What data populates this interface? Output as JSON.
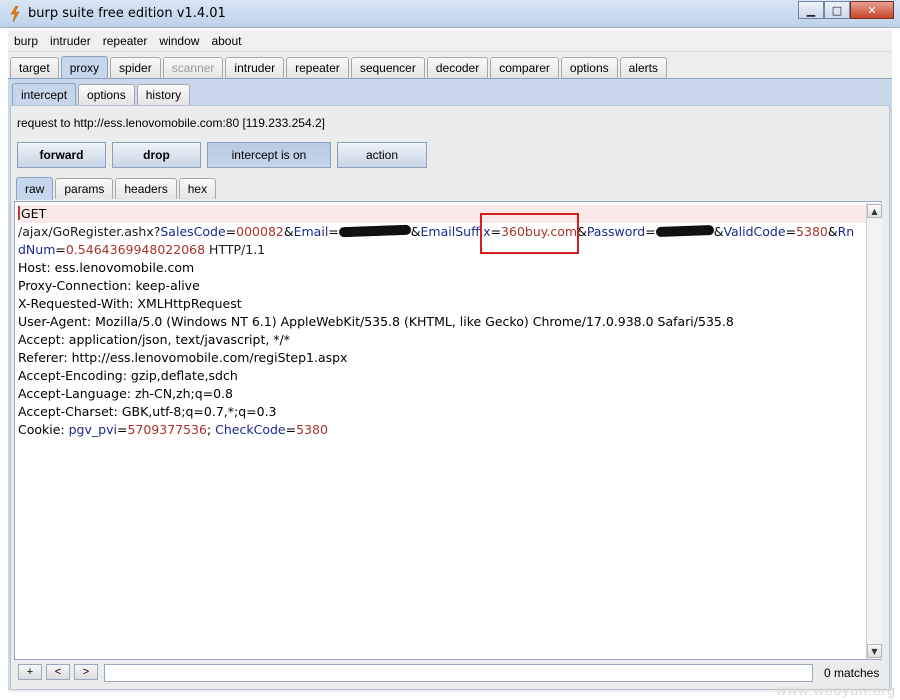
{
  "window": {
    "title": "burp suite free edition v1.4.01",
    "controls": {
      "minimize": "▁",
      "maximize": "□",
      "close": "✕"
    }
  },
  "menu": [
    "burp",
    "intruder",
    "repeater",
    "window",
    "about"
  ],
  "main_tabs": [
    {
      "label": "target"
    },
    {
      "label": "proxy",
      "active": true
    },
    {
      "label": "spider"
    },
    {
      "label": "scanner",
      "disabled": true
    },
    {
      "label": "intruder"
    },
    {
      "label": "repeater"
    },
    {
      "label": "sequencer"
    },
    {
      "label": "decoder"
    },
    {
      "label": "comparer"
    },
    {
      "label": "options"
    },
    {
      "label": "alerts"
    }
  ],
  "proxy_tabs": [
    {
      "label": "intercept",
      "active": true
    },
    {
      "label": "options"
    },
    {
      "label": "history"
    }
  ],
  "request_info": "request to http://ess.lenovomobile.com:80  [119.233.254.2]",
  "buttons": {
    "forward": "forward",
    "drop": "drop",
    "intercept": "intercept is on",
    "action": "action"
  },
  "view_tabs": [
    {
      "label": "raw",
      "active": true
    },
    {
      "label": "params"
    },
    {
      "label": "headers"
    },
    {
      "label": "hex"
    }
  ],
  "request": {
    "method": "GET",
    "path": "/ajax/GoRegister.ashx?",
    "params": {
      "sales_code_key": "SalesCode",
      "sales_code_val": "000082",
      "email_key": "Email",
      "email_suffix_key": "EmailSuffix",
      "email_suffix_val": "360buy.com",
      "password_key": "Password",
      "valid_code_key": "ValidCode",
      "valid_code_val": "5380",
      "rn_key_part1": "Rn",
      "rn_key_part2": "dNum",
      "rn_val": "0.5464369948022068",
      "protocol": "HTTP/1.1"
    },
    "headers": [
      "Host: ess.lenovomobile.com",
      "Proxy-Connection: keep-alive",
      "X-Requested-With: XMLHttpRequest",
      "User-Agent: Mozilla/5.0 (Windows NT 6.1) AppleWebKit/535.8 (KHTML, like Gecko) Chrome/17.0.938.0 Safari/535.8",
      "Accept: application/json, text/javascript, */*",
      "Referer: http://ess.lenovomobile.com/regiStep1.aspx",
      "Accept-Encoding: gzip,deflate,sdch",
      "Accept-Language: zh-CN,zh;q=0.8",
      "Accept-Charset: GBK,utf-8;q=0.7,*;q=0.3"
    ],
    "cookie": {
      "label": "Cookie: ",
      "pgv_key": "pgv_pvi",
      "pgv_val": "5709377536",
      "check_key": "CheckCode",
      "check_val": "5380"
    }
  },
  "search": {
    "plus": "+",
    "prev": "<",
    "next": ">",
    "value": "",
    "matches": "0 matches"
  },
  "watermark": "www.wooyun.org"
}
